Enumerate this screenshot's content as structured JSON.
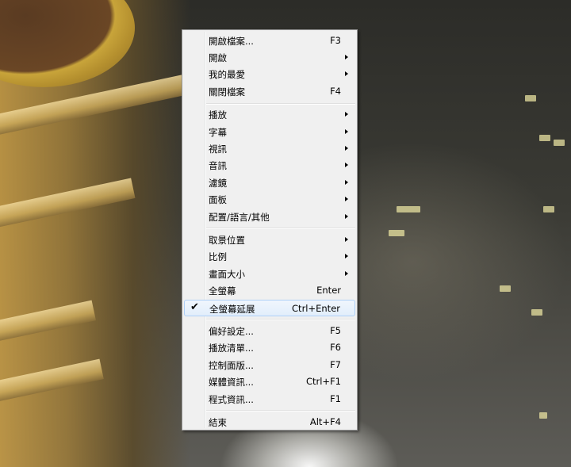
{
  "menu": {
    "items": [
      {
        "label": "開啟檔案...",
        "shortcut": "F3"
      },
      {
        "label": "開啟",
        "shortcut": "",
        "submenu": true
      },
      {
        "label": "我的最愛",
        "shortcut": "",
        "submenu": true
      },
      {
        "label": "關閉檔案",
        "shortcut": "F4"
      },
      {
        "label": "播放",
        "shortcut": "",
        "submenu": true
      },
      {
        "label": "字幕",
        "shortcut": "",
        "submenu": true
      },
      {
        "label": "視訊",
        "shortcut": "",
        "submenu": true
      },
      {
        "label": "音訊",
        "shortcut": "",
        "submenu": true
      },
      {
        "label": "濾鏡",
        "shortcut": "",
        "submenu": true
      },
      {
        "label": "面板",
        "shortcut": "",
        "submenu": true
      },
      {
        "label": "配置/語言/其他",
        "shortcut": "",
        "submenu": true
      },
      {
        "label": "取景位置",
        "shortcut": "",
        "submenu": true
      },
      {
        "label": "比例",
        "shortcut": "",
        "submenu": true
      },
      {
        "label": "畫面大小",
        "shortcut": "",
        "submenu": true
      },
      {
        "label": "全螢幕",
        "shortcut": "Enter"
      },
      {
        "label": "全螢幕延展",
        "shortcut": "Ctrl+Enter",
        "checked": true
      },
      {
        "label": "偏好設定...",
        "shortcut": "F5"
      },
      {
        "label": "播放清單...",
        "shortcut": "F6"
      },
      {
        "label": "控制面版...",
        "shortcut": "F7"
      },
      {
        "label": "媒體資訊...",
        "shortcut": "Ctrl+F1"
      },
      {
        "label": "程式資訊...",
        "shortcut": "F1"
      },
      {
        "label": "結束",
        "shortcut": "Alt+F4"
      }
    ],
    "check_glyph": "✔"
  }
}
